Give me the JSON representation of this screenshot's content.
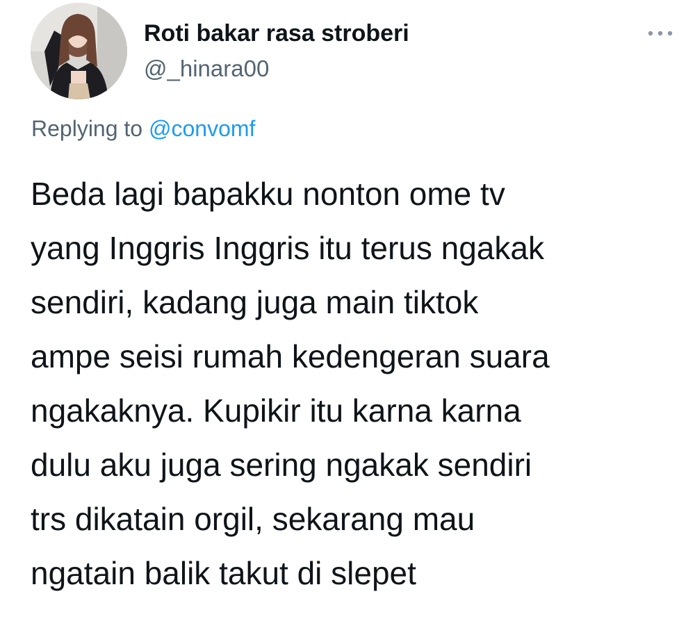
{
  "author": {
    "display_name": "Roti bakar rasa stroberi",
    "handle": "@_hinara00",
    "avatar_icon": "profile-photo"
  },
  "menu": {
    "icon": "more-horizontal-icon"
  },
  "reply": {
    "prefix": "Replying to",
    "mention": "@convomf"
  },
  "tweet": {
    "lines": [
      "Beda lagi bapakku nonton ome tv",
      "yang Inggris Inggris itu terus ngakak",
      "sendiri, kadang juga main tiktok",
      "ampe seisi rumah kedengeran suara",
      "ngakaknya. Kupikir itu karna karna",
      "dulu aku juga sering ngakak sendiri",
      "trs dikatain orgil, sekarang mau",
      "ngatain balik takut di slepet"
    ]
  },
  "colors": {
    "text": "#0f1419",
    "secondary": "#536471",
    "link": "#1d9bf0"
  }
}
